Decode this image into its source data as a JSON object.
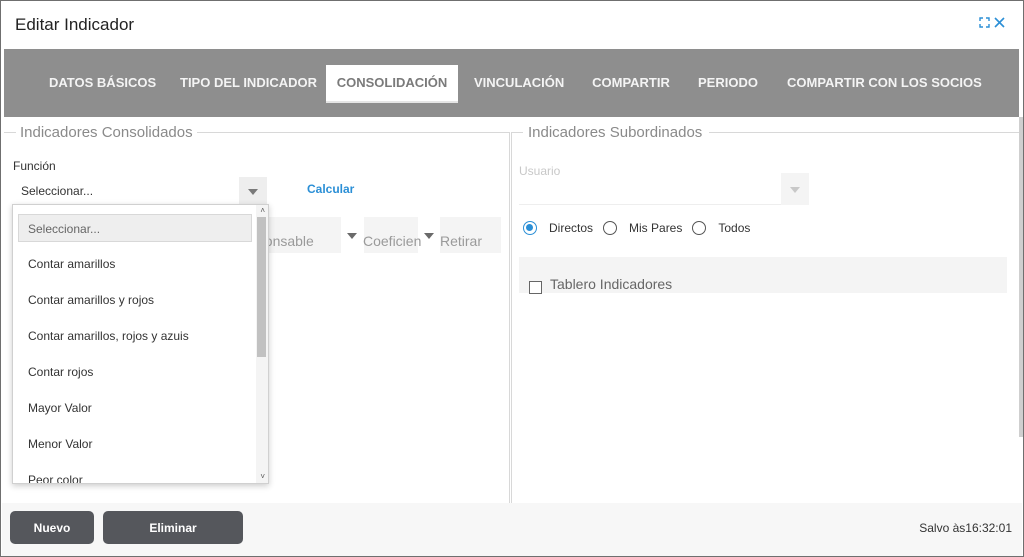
{
  "dialog": {
    "title": "Editar Indicador"
  },
  "tabs": [
    {
      "label": "DATOS BÁSICOS"
    },
    {
      "label": "TIPO DEL INDICADOR"
    },
    {
      "label": "CONSOLIDACIÓN",
      "active": true
    },
    {
      "label": "VINCULACIÓN"
    },
    {
      "label": "COMPARTIR"
    },
    {
      "label": "PERIODO"
    },
    {
      "label": "COMPARTIR CON LOS SOCIOS"
    }
  ],
  "left_panel": {
    "legend": "Indicadores Consolidados",
    "function_label": "Función",
    "function_selected": "Seleccionar...",
    "calcular": "Calcular",
    "columns": {
      "responsable": "ponsable",
      "coeficiente": "Coeficien",
      "retirar": "Retirar"
    }
  },
  "dropdown": {
    "search_placeholder": "Seleccionar...",
    "options": [
      "Contar amarillos",
      "Contar amarillos y rojos",
      "Contar amarillos, rojos y azuis",
      "Contar rojos",
      "Mayor Valor",
      "Menor Valor",
      "Peor color"
    ]
  },
  "right_panel": {
    "legend": "Indicadores Subordinados",
    "usuario_label": "Usuario",
    "radios": [
      {
        "label": "Directos",
        "checked": true
      },
      {
        "label": "Mis Pares",
        "checked": false
      },
      {
        "label": "Todos",
        "checked": false
      }
    ],
    "tablero_label": "Tablero Indicadores"
  },
  "footer": {
    "nuevo": "Nuevo",
    "eliminar": "Eliminar",
    "saved": "Salvo às16:32:01"
  },
  "colors": {
    "accent": "#2b8fd6",
    "tabbar": "#8e8e8e",
    "button": "#55575c"
  }
}
